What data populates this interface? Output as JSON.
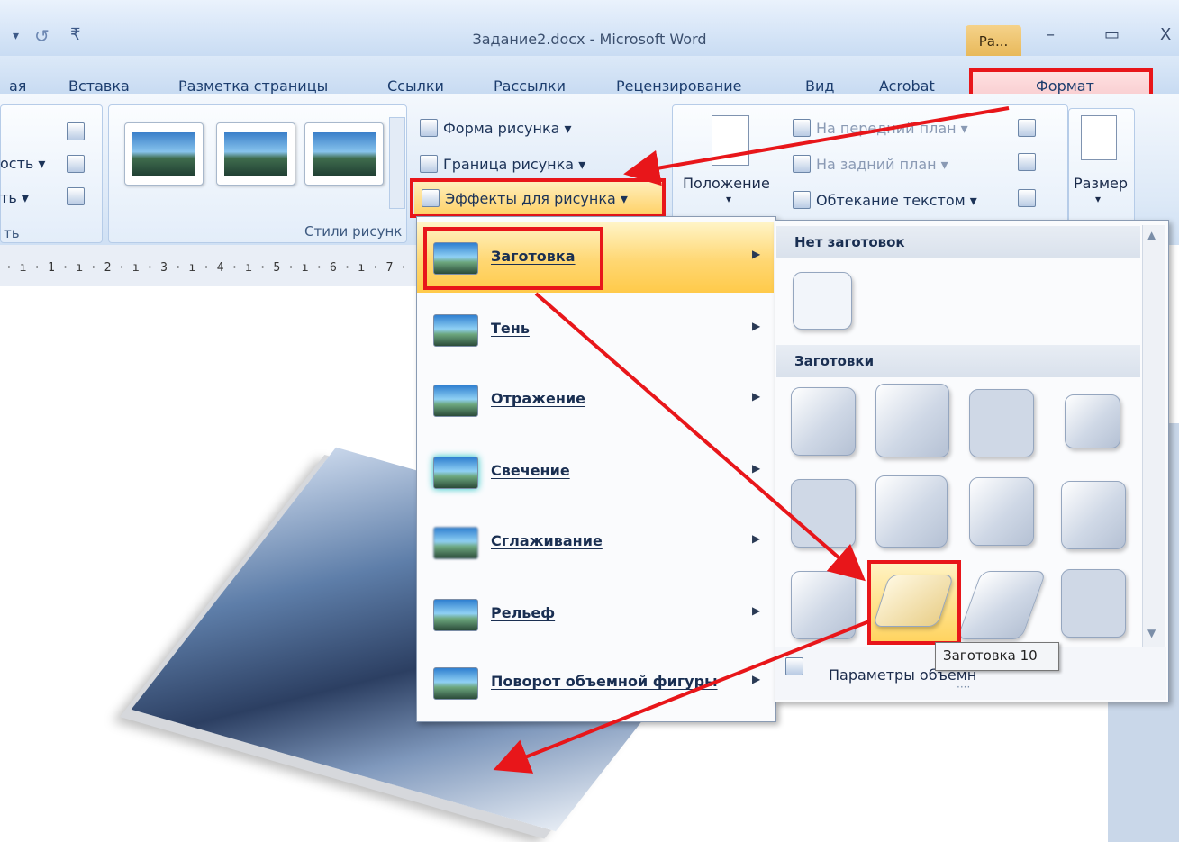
{
  "window": {
    "title": "Задание2.docx - Microsoft Word",
    "context_tab": "Ра...",
    "minimize_glyph": "–",
    "maximize_glyph": "▭",
    "close_glyph": "X"
  },
  "quick_access": {
    "dropdown_glyph": "▾",
    "undo_glyph": "↺",
    "customize_glyph": "₹"
  },
  "tabs": [
    "ая",
    "Вставка",
    "Разметка страницы",
    "Ссылки",
    "Рассылки",
    "Рецензирование",
    "Вид",
    "Acrobat",
    "Формат"
  ],
  "ribbon": {
    "left_fragments": [
      "ость ▾",
      "ть ▾",
      "ть"
    ],
    "styles_group_label": "Стили рисунк",
    "shape_button": "Форма рисунка ▾",
    "border_button": "Граница рисунка ▾",
    "effects_button": "Эффекты для рисунка ▾",
    "position_button": "Положение",
    "position_arrow": "▾",
    "bring_front": "На передний план ▾",
    "send_back": "На задний план ▾",
    "text_wrap": "Обтекание текстом ▾",
    "size_button": "Размер",
    "size_arrow": "▾"
  },
  "ruler": {
    "text": "· ı · 1 · ı · 2 · ı · 3 · ı · 4 · ı · 5 · ı · 6 · ı · 7 ·"
  },
  "effects_menu": {
    "items": [
      {
        "label": "Заготовка",
        "arrow": "▶"
      },
      {
        "label": "Тень",
        "arrow": "▶"
      },
      {
        "label": "Отражение",
        "arrow": "▶"
      },
      {
        "label": "Свечение",
        "arrow": "▶"
      },
      {
        "label": "Сглаживание",
        "arrow": "▶"
      },
      {
        "label": "Рельеф",
        "arrow": "▶"
      },
      {
        "label": "Поворот объемной фигуры",
        "arrow": "▶"
      }
    ]
  },
  "gallery": {
    "no_presets_header": "Нет заготовок",
    "presets_header": "Заготовки",
    "footer_label": "Параметры объемн",
    "tooltip": "Заготовка 10",
    "scroll_up": "▲",
    "scroll_down": "▼",
    "grip": "····"
  },
  "colors": {
    "highlight_red": "#e8161a",
    "active_orange": "#ffd772"
  }
}
